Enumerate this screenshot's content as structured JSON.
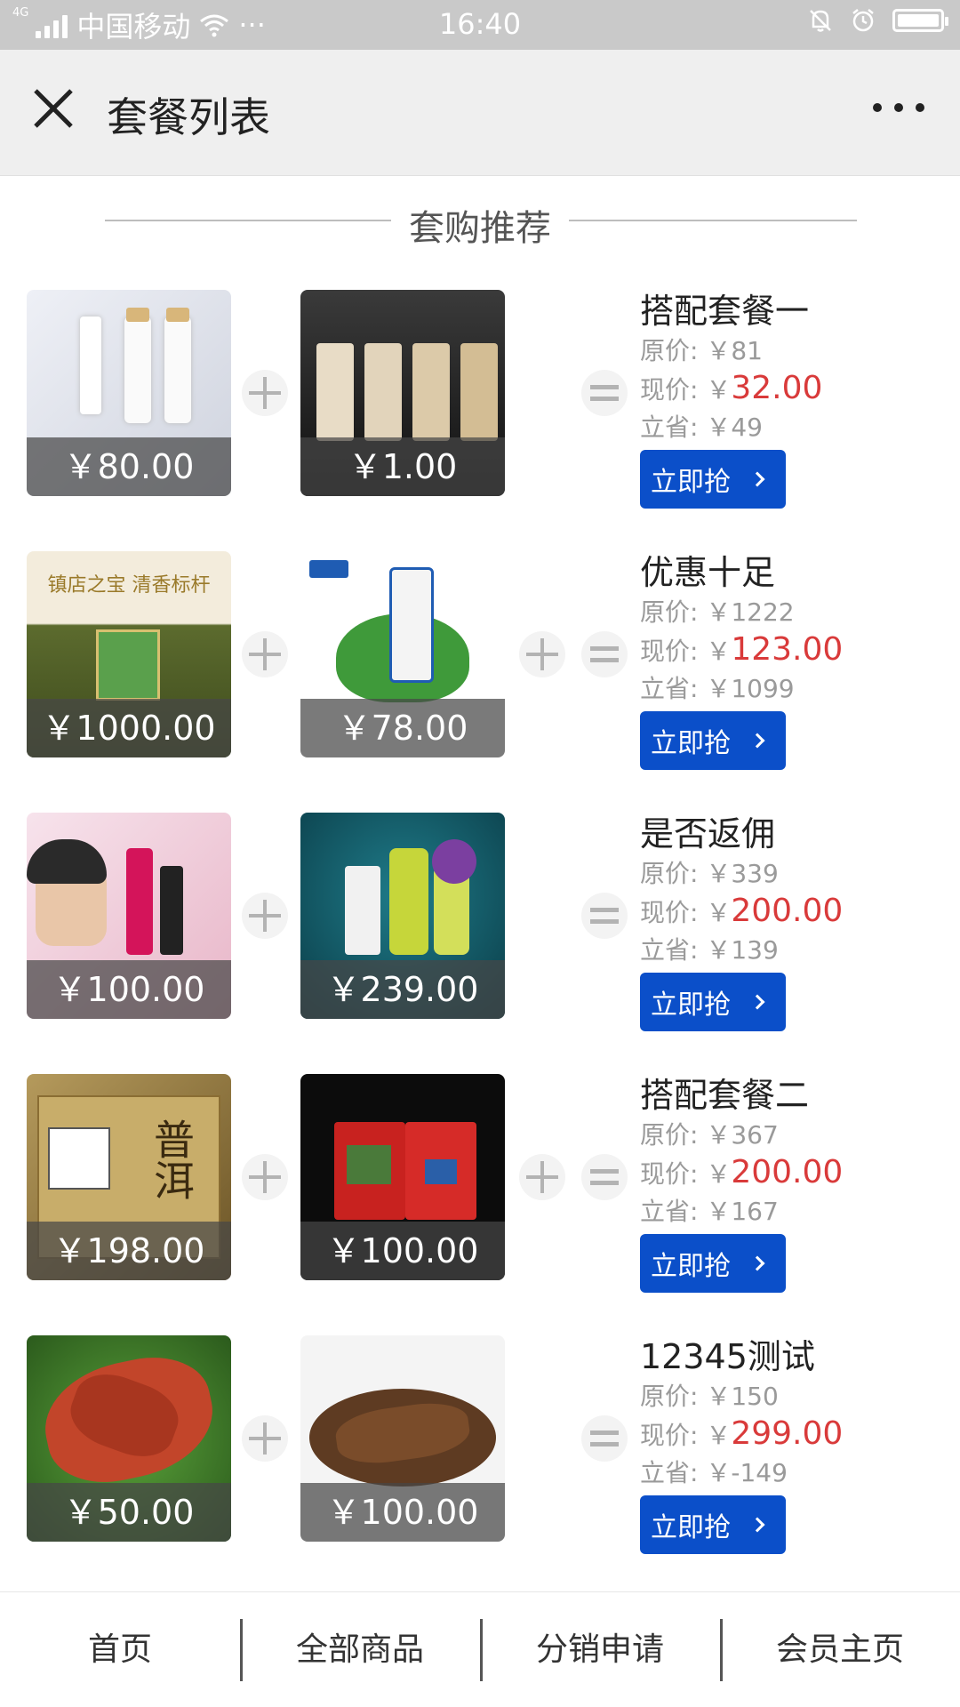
{
  "status_bar": {
    "network": "4G",
    "carrier": "中国移动",
    "more": "···",
    "time": "16:40"
  },
  "header": {
    "title": "套餐列表"
  },
  "section": {
    "title": "套购推荐"
  },
  "labels": {
    "original": "原价: ￥",
    "current": "现价: ￥",
    "saved": "立省: ￥",
    "buy": "立即抢"
  },
  "packages": [
    {
      "name": "搭配套餐一",
      "item1_price": "￥80.00",
      "item2_price": "￥1.00",
      "original": "81",
      "current": "32.00",
      "saved": "49",
      "has_plus2": false
    },
    {
      "name": "优惠十足",
      "item1_price": "￥1000.00",
      "item2_price": "￥78.00",
      "original": "1222",
      "current": "123.00",
      "saved": "1099",
      "has_plus2": true
    },
    {
      "name": "是否返佣",
      "item1_price": "￥100.00",
      "item2_price": "￥239.00",
      "original": "339",
      "current": "200.00",
      "saved": "139",
      "has_plus2": false
    },
    {
      "name": "搭配套餐二",
      "item1_price": "￥198.00",
      "item2_price": "￥100.00",
      "original": "367",
      "current": "200.00",
      "saved": "167",
      "has_plus2": true
    },
    {
      "name": "12345测试",
      "item1_price": "￥50.00",
      "item2_price": "￥100.00",
      "original": "150",
      "current": "299.00",
      "saved": "-149",
      "has_plus2": false
    }
  ],
  "bottom_nav": [
    "首页",
    "全部商品",
    "分销申请",
    "会员主页"
  ],
  "colors": {
    "accent_button": "#0b4fc9",
    "price_red": "#d93a3a"
  }
}
